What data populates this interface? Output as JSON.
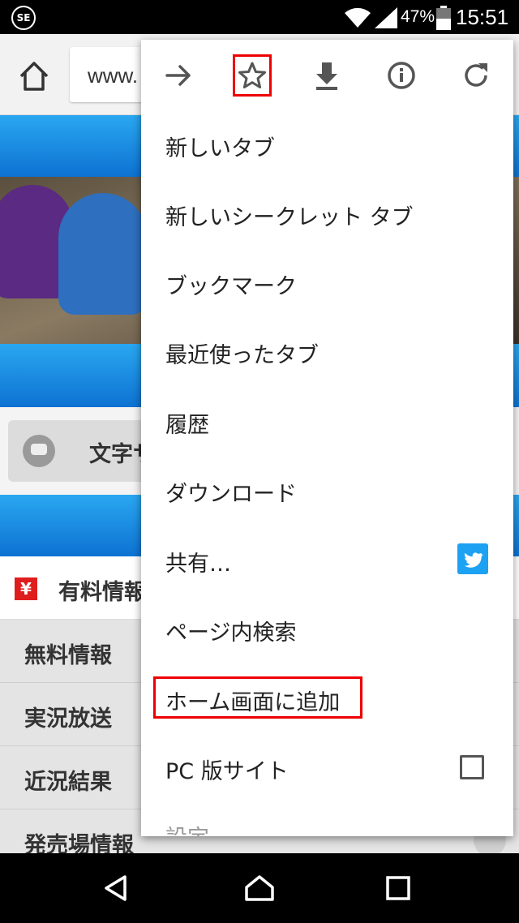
{
  "status_bar": {
    "app_icon_text": "SE",
    "battery_percent": "47%",
    "time": "15:51"
  },
  "browser": {
    "url_partial": "www."
  },
  "page": {
    "text_size_label": "文字サ",
    "nav_items": [
      "有料情報",
      "無料情報",
      "実況放送",
      "近況結果",
      "発売場情報"
    ]
  },
  "menu": {
    "icons": [
      "forward-icon",
      "star-icon",
      "download-icon",
      "info-icon",
      "reload-icon"
    ],
    "items": [
      "新しいタブ",
      "新しいシークレット タブ",
      "ブックマーク",
      "最近使ったタブ",
      "履歴",
      "ダウンロード",
      "共有…",
      "ページ内検索",
      "ホーム画面に追加",
      "PC 版サイト",
      "設定"
    ],
    "highlight_color": "#e00000"
  }
}
